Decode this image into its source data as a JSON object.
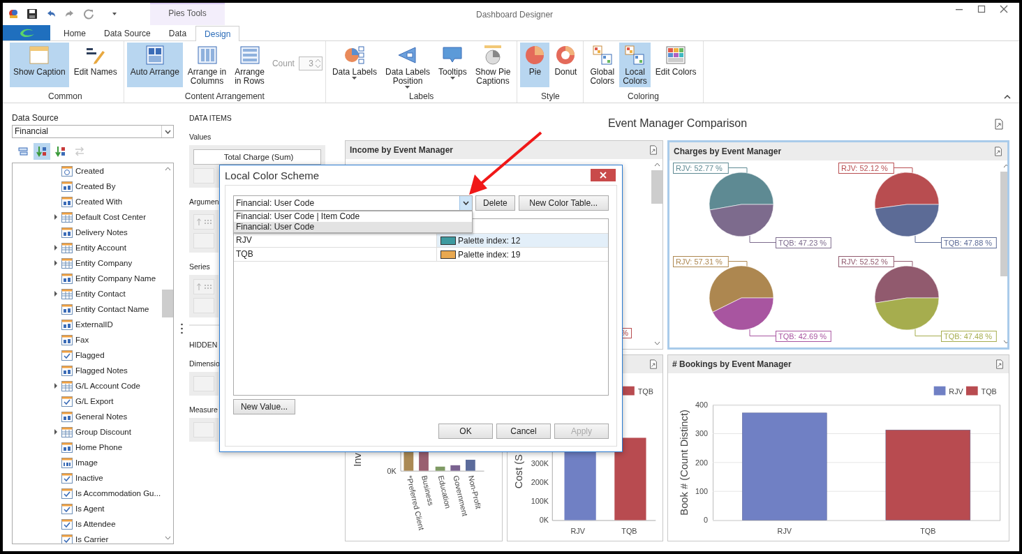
{
  "window": {
    "title": "Dashboard Designer",
    "context_header": "Pies Tools"
  },
  "tabs": [
    {
      "label": "Home",
      "selected": false
    },
    {
      "label": "Data Source",
      "selected": false
    },
    {
      "label": "Data",
      "selected": false
    },
    {
      "label": "Design",
      "selected": true
    }
  ],
  "ribbon": {
    "groups": [
      {
        "label": "Common",
        "items": [
          {
            "kind": "large",
            "label": "Show Caption",
            "selected": true,
            "dropdown": false
          },
          {
            "kind": "large",
            "label": "Edit Names",
            "selected": false,
            "dropdown": false
          }
        ]
      },
      {
        "label": "Content Arrangement",
        "items": [
          {
            "kind": "large",
            "label": "Auto Arrange",
            "selected": true,
            "dropdown": false
          },
          {
            "kind": "large",
            "label": "Arrange in\nColumns",
            "selected": false,
            "dropdown": false
          },
          {
            "kind": "large",
            "label": "Arrange\nin Rows",
            "selected": false,
            "dropdown": false
          },
          {
            "kind": "spinner",
            "label": "Count",
            "value": "3",
            "disabled": true
          }
        ]
      },
      {
        "label": "Labels",
        "items": [
          {
            "kind": "large",
            "label": "Data Labels",
            "selected": false,
            "dropdown": true
          },
          {
            "kind": "large",
            "label": "Data Labels\nPosition",
            "selected": false,
            "dropdown": true
          },
          {
            "kind": "large",
            "label": "Tooltips",
            "selected": false,
            "dropdown": true
          },
          {
            "kind": "large",
            "label": "Show Pie\nCaptions",
            "selected": false,
            "dropdown": false
          }
        ]
      },
      {
        "label": "Style",
        "items": [
          {
            "kind": "large",
            "label": "Pie",
            "selected": true,
            "dropdown": false
          },
          {
            "kind": "large",
            "label": "Donut",
            "selected": false,
            "dropdown": false
          }
        ]
      },
      {
        "label": "Coloring",
        "items": [
          {
            "kind": "large",
            "label": "Global\nColors",
            "selected": false,
            "dropdown": false
          },
          {
            "kind": "large",
            "label": "Local\nColors",
            "selected": true,
            "dropdown": false
          },
          {
            "kind": "large",
            "label": "Edit Colors",
            "selected": false,
            "dropdown": false
          }
        ]
      }
    ]
  },
  "data_source": {
    "label": "Data Source",
    "value": "Financial"
  },
  "field_toolbar": [
    {
      "selected": false,
      "disabled": false
    },
    {
      "selected": true,
      "disabled": false
    },
    {
      "selected": false,
      "disabled": false
    },
    {
      "selected": false,
      "disabled": true
    }
  ],
  "fields": [
    {
      "label": "Created",
      "kind": "date",
      "expandable": false
    },
    {
      "label": "Created By",
      "kind": "text",
      "expandable": false
    },
    {
      "label": "Created With",
      "kind": "text",
      "expandable": false
    },
    {
      "label": "Default Cost Center",
      "kind": "table",
      "expandable": true
    },
    {
      "label": "Delivery Notes",
      "kind": "text",
      "expandable": false
    },
    {
      "label": "Entity Account",
      "kind": "table",
      "expandable": true
    },
    {
      "label": "Entity Company",
      "kind": "table",
      "expandable": true
    },
    {
      "label": "Entity Company Name",
      "kind": "text",
      "expandable": false
    },
    {
      "label": "Entity Contact",
      "kind": "table",
      "expandable": true
    },
    {
      "label": "Entity Contact Name",
      "kind": "text",
      "expandable": false
    },
    {
      "label": "ExternalID",
      "kind": "text",
      "expandable": false
    },
    {
      "label": "Fax",
      "kind": "text",
      "expandable": false
    },
    {
      "label": "Flagged",
      "kind": "check",
      "expandable": false
    },
    {
      "label": "Flagged Notes",
      "kind": "text",
      "expandable": false
    },
    {
      "label": "G/L Account Code",
      "kind": "table",
      "expandable": true
    },
    {
      "label": "G/L Export",
      "kind": "check",
      "expandable": false
    },
    {
      "label": "General Notes",
      "kind": "text",
      "expandable": false
    },
    {
      "label": "Group Discount",
      "kind": "table",
      "expandable": true
    },
    {
      "label": "Home Phone",
      "kind": "text",
      "expandable": false
    },
    {
      "label": "Image",
      "kind": "number",
      "expandable": false
    },
    {
      "label": "Inactive",
      "kind": "check",
      "expandable": false
    },
    {
      "label": "Is Accommodation Gu...",
      "kind": "check",
      "expandable": false
    },
    {
      "label": "Is Agent",
      "kind": "check",
      "expandable": false
    },
    {
      "label": "Is Attendee",
      "kind": "check",
      "expandable": false
    },
    {
      "label": "Is Carrier",
      "kind": "check",
      "expandable": false
    }
  ],
  "data_items": {
    "heading": "DATA ITEMS",
    "values_label": "Values",
    "value_item": "Total Charge (Sum)",
    "arguments_label": "Argumen",
    "series_label": "Series",
    "hidden_heading": "HIDDEN",
    "dimensions_label": "Dimensio",
    "measures_label": "Measure"
  },
  "dashboard": {
    "title": "Event Manager Comparison",
    "income_panel": {
      "title": "Income by Event Manager",
      "partial_label": "%"
    },
    "charges_panel": {
      "title": "Charges by Event Manager",
      "selected": true,
      "pies": [
        {
          "slices": [
            {
              "color": "#5e8a93"
            },
            {
              "color": "#7d6b8d"
            }
          ],
          "chart_data": {
            "type": "pie",
            "values": [
              52.77,
              47.23
            ],
            "value_labels": [
              "RJV: 52.77 %",
              "TQB: 47.23 %"
            ]
          }
        },
        {
          "slices": [
            {
              "color": "#b84d50"
            },
            {
              "color": "#5c6b96"
            }
          ],
          "chart_data": {
            "type": "pie",
            "values": [
              52.12,
              47.88
            ],
            "value_labels": [
              "RJV: 52.12 %",
              "TQB: 47.88 %"
            ]
          }
        },
        {
          "slices": [
            {
              "color": "#ad8750"
            },
            {
              "color": "#a855a0"
            }
          ],
          "chart_data": {
            "type": "pie",
            "values": [
              57.31,
              42.69
            ],
            "value_labels": [
              "RJV: 57.31 %",
              "TQB: 42.69 %"
            ]
          }
        },
        {
          "slices": [
            {
              "color": "#915a6e"
            },
            {
              "color": "#a6ad4e"
            }
          ],
          "chart_data": {
            "type": "pie",
            "values": [
              52.52,
              47.48
            ],
            "value_labels": [
              "RJV: 52.52 %",
              "TQB: 47.48 %"
            ]
          }
        }
      ]
    },
    "income_bar_panel": {
      "ylabel": "Inv",
      "ytick": "0K",
      "categories": [
        "*Preferred Client",
        "Business",
        "Education",
        "Government",
        "Non-Profit"
      ]
    },
    "cost_panel": {
      "legend": [
        {
          "label": "TQB",
          "color": "#b84b50"
        }
      ],
      "ylabel": "Cost (S",
      "yticks": [
        "300K",
        "200K",
        "100K",
        "0K"
      ],
      "categories": [
        "RJV",
        "TQB"
      ]
    },
    "bookings_panel": {
      "title": "# Bookings by Event Manager",
      "chart_data": {
        "type": "bar",
        "ylabel": "Book # (Count Distinct)",
        "categories": [
          "RJV",
          "TQB"
        ],
        "series": [
          {
            "name": "RJV",
            "color": "#7080c4",
            "values": [
              372,
              null
            ]
          },
          {
            "name": "TQB",
            "color": "#b84b50",
            "values": [
              null,
              313
            ]
          }
        ],
        "ylim": [
          0,
          400
        ],
        "yticks": [
          0,
          100,
          200,
          300,
          400
        ],
        "grid": true,
        "legend": true
      }
    }
  },
  "dialog": {
    "title": "Local Color Scheme",
    "scheme": {
      "value": "Financial: User Code",
      "expanded": true
    },
    "options": [
      {
        "label": "Financial: User Code | Item Code",
        "selected": false
      },
      {
        "label": "Financial: User Code",
        "selected": true
      }
    ],
    "delete_button": "Delete",
    "new_table_button": "New Color Table...",
    "new_value_button": "New Value...",
    "rows": [
      {
        "value": "RJV",
        "color": "#3d9aa0",
        "palette": "Palette index: 12",
        "selected": true
      },
      {
        "value": "TQB",
        "color": "#e8a850",
        "palette": "Palette index: 19",
        "selected": false
      }
    ],
    "footer_buttons": [
      {
        "label": "OK",
        "disabled": false
      },
      {
        "label": "Cancel",
        "disabled": false
      },
      {
        "label": "Apply",
        "disabled": true
      }
    ]
  }
}
